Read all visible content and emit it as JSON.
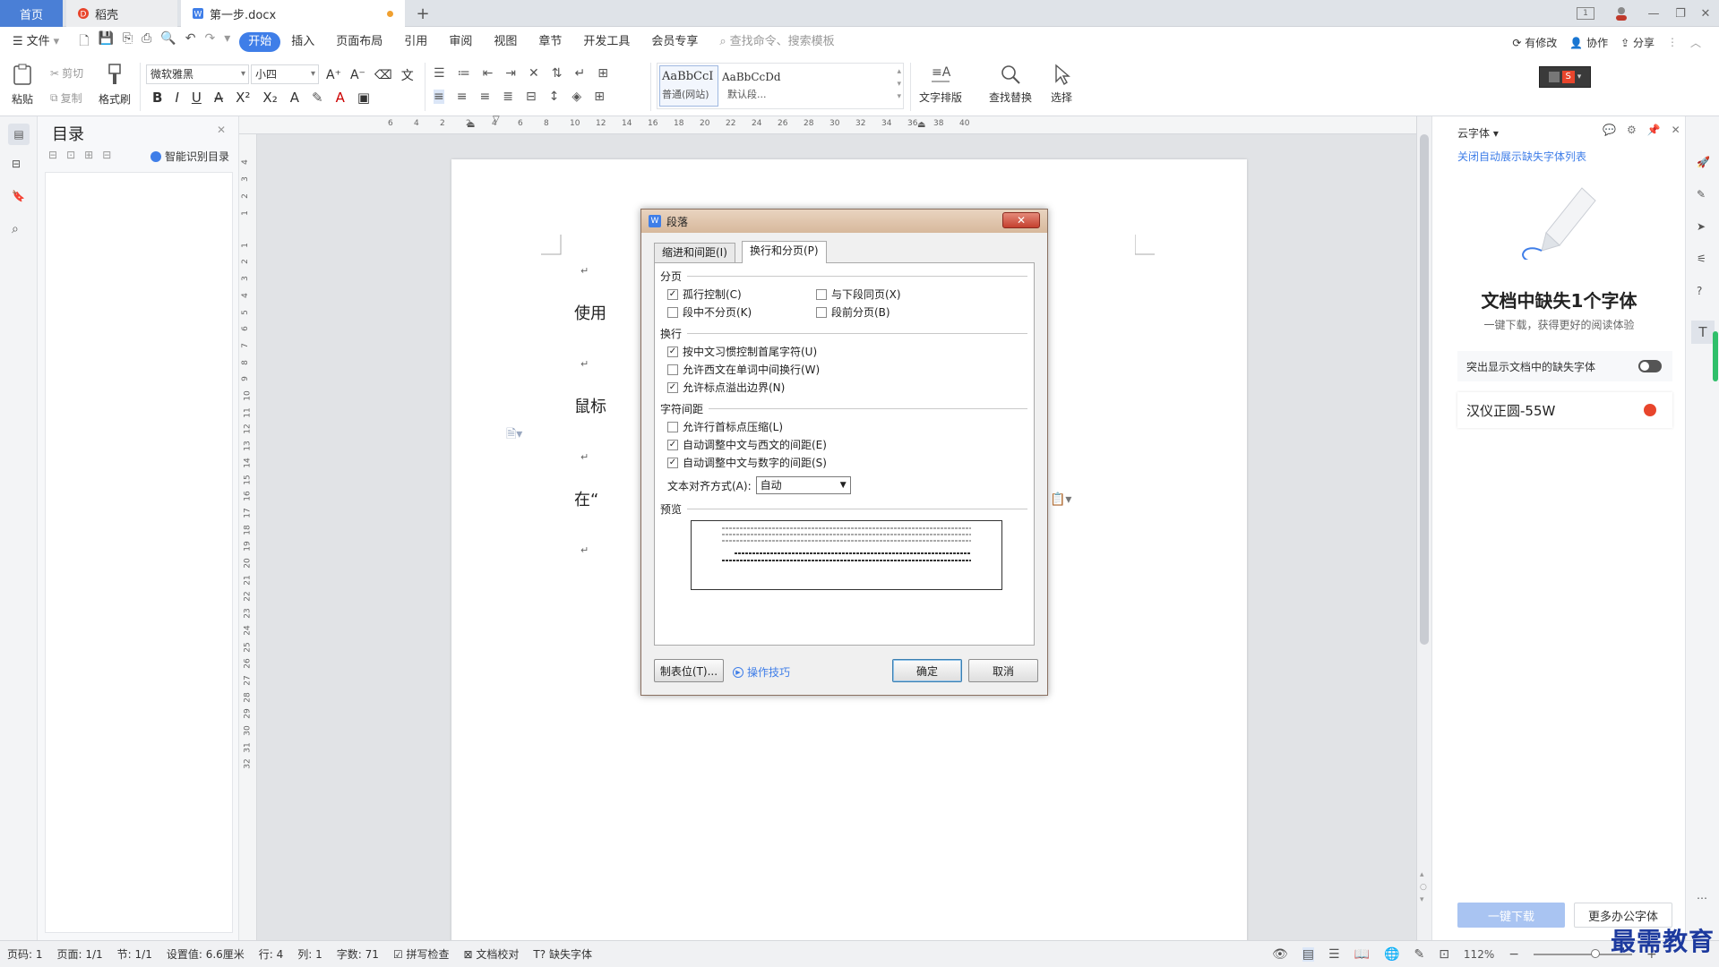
{
  "titlebar": {
    "tabs": [
      "首页",
      "稻壳",
      "第一步.docx"
    ],
    "new_tab": "+",
    "badge": "1"
  },
  "menubar": {
    "file": "文件",
    "items": [
      "开始",
      "插入",
      "页面布局",
      "引用",
      "审阅",
      "视图",
      "章节",
      "开发工具",
      "会员专享"
    ],
    "search_placeholder": "查找命令、搜索模板",
    "right": [
      "有修改",
      "协作",
      "分享"
    ]
  },
  "ribbon": {
    "paste": "粘贴",
    "cut": "剪切",
    "copy": "复制",
    "format_painter": "格式刷",
    "font_name": "微软雅黑",
    "font_size": "小四",
    "style1_sample": "AaBbCcI",
    "style1_label": "普通(网站)",
    "style2_sample": "AaBbCcDd",
    "style2_label": "默认段...",
    "text_layout": "文字排版",
    "find_replace": "查找替换",
    "select": "选择"
  },
  "nav": {
    "title": "目录",
    "smart_toc": "智能识别目录"
  },
  "ruler": {
    "h_ticks": [
      "6",
      "4",
      "2",
      "2",
      "4",
      "6",
      "8",
      "10",
      "12",
      "14",
      "16",
      "18",
      "20",
      "22",
      "24",
      "26",
      "28",
      "30",
      "32",
      "34",
      "36",
      "38",
      "40"
    ],
    "v_ticks": [
      "4",
      "3",
      "2",
      "1",
      "1",
      "2",
      "3",
      "4",
      "5",
      "6",
      "7",
      "8",
      "9",
      "10",
      "11",
      "12",
      "13",
      "14",
      "15",
      "16",
      "17",
      "18",
      "19",
      "20",
      "21",
      "22",
      "23",
      "24",
      "25",
      "26",
      "27",
      "28",
      "29",
      "30",
      "31",
      "32"
    ]
  },
  "document": {
    "lines": [
      "使用",
      "鼠标",
      "在“"
    ],
    "return_mark": "↵"
  },
  "dialog": {
    "title": "段落",
    "tabs": [
      "缩进和间距(I)",
      "换行和分页(P)"
    ],
    "group_pagination": "分页",
    "widow": "孤行控制(C)",
    "keep_next": "与下段同页(X)",
    "keep_lines": "段中不分页(K)",
    "page_break_before": "段前分页(B)",
    "group_linebreak": "换行",
    "cjk_rules": "按中文习惯控制首尾字符(U)",
    "latin_wrap": "允许西文在单词中间换行(W)",
    "hanging_punct": "允许标点溢出边界(N)",
    "group_spacing": "字符间距",
    "compress_punct": "允许行首标点压缩(L)",
    "auto_space_latin": "自动调整中文与西文的间距(E)",
    "auto_space_digit": "自动调整中文与数字的间距(S)",
    "text_align_label": "文本对齐方式(A):",
    "text_align_value": "自动",
    "group_preview": "预览",
    "tabs_button": "制表位(T)...",
    "tips": "操作技巧",
    "ok": "确定",
    "cancel": "取消",
    "checkbox_states": {
      "widow": true,
      "keep_next": false,
      "keep_lines": false,
      "page_break_before": false,
      "cjk_rules": true,
      "latin_wrap": false,
      "hanging_punct": true,
      "compress_punct": false,
      "auto_space_latin": true,
      "auto_space_digit": true
    }
  },
  "rightpanel": {
    "title": "云字体",
    "link": "关闭自动展示缺失字体列表",
    "heading": "文档中缺失1个字体",
    "sub": "一键下载，获得更好的阅读体验",
    "toggle_label": "突出显示文档中的缺失字体",
    "font_item": "汉仪正圆-55W",
    "download_btn": "一键下载",
    "more_btn": "更多办公字体"
  },
  "statusbar": {
    "items": [
      "页码: 1",
      "页面: 1/1",
      "节: 1/1",
      "设置值: 6.6厘米",
      "行: 4",
      "列: 1",
      "字数: 71",
      "拼写检查",
      "文档校对",
      "缺失字体"
    ],
    "zoom": "112%"
  },
  "watermark": "最需教育",
  "colors": {
    "accent": "#3f7ee8",
    "home_tab": "#4a7fd6",
    "dialog_title": "#d7b89c",
    "close_btn": "#c4402f",
    "font_warn": "#e8452c"
  }
}
